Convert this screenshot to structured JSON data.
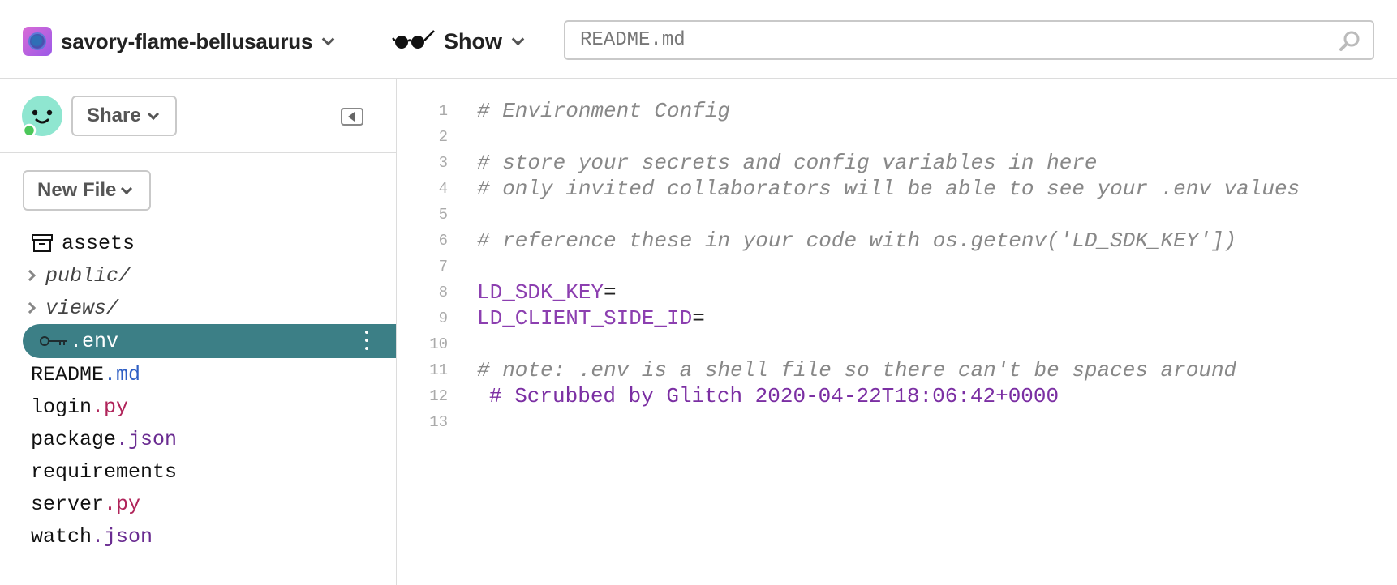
{
  "header": {
    "project_name": "savory-flame-bellusaurus",
    "show_label": "Show",
    "search_value": "README.md"
  },
  "sidebar": {
    "share_label": "Share",
    "new_file_label": "New File",
    "files": [
      {
        "name": "assets",
        "ext": "",
        "kind": "assets"
      },
      {
        "name": "public/",
        "ext": "",
        "kind": "folder"
      },
      {
        "name": "views/",
        "ext": "",
        "kind": "folder"
      },
      {
        "name": ".env",
        "ext": "",
        "kind": "env",
        "active": true
      },
      {
        "name": "README",
        "ext": ".md",
        "ext_color": "#2f5fc4"
      },
      {
        "name": "login",
        "ext": ".py",
        "ext_color": "#b0245a"
      },
      {
        "name": "package",
        "ext": ".json",
        "ext_color": "#6a2c91"
      },
      {
        "name": "requirements",
        "ext": ""
      },
      {
        "name": "server",
        "ext": ".py",
        "ext_color": "#b0245a"
      },
      {
        "name": "watch",
        "ext": ".json",
        "ext_color": "#6a2c91"
      }
    ]
  },
  "editor": {
    "lines": [
      {
        "n": "1",
        "text": "# Environment Config",
        "type": "comment"
      },
      {
        "n": "2",
        "text": "",
        "type": "plain"
      },
      {
        "n": "3",
        "text": "# store your secrets and config variables in here",
        "type": "comment"
      },
      {
        "n": "4",
        "text": "# only invited collaborators will be able to see your .env values",
        "type": "comment"
      },
      {
        "n": "5",
        "text": "",
        "type": "plain"
      },
      {
        "n": "6",
        "text": "# reference these in your code with os.getenv('LD_SDK_KEY'])",
        "type": "comment"
      },
      {
        "n": "7",
        "text": "",
        "type": "plain"
      },
      {
        "n": "8",
        "text": "LD_SDK_KEY",
        "suffix": "=",
        "type": "key"
      },
      {
        "n": "9",
        "text": "LD_CLIENT_SIDE_ID",
        "suffix": "=",
        "type": "key"
      },
      {
        "n": "10",
        "text": "",
        "type": "plain"
      },
      {
        "n": "11",
        "text": "# note: .env is a shell file so there can't be spaces around",
        "type": "comment"
      },
      {
        "n": "12",
        "text": "# Scrubbed by Glitch 2020-04-22T18:06:42+0000",
        "type": "scrub"
      },
      {
        "n": "13",
        "text": "",
        "type": "plain"
      }
    ]
  },
  "colors": {
    "active_file_bg": "#3c7f86",
    "comment": "#888888",
    "key": "#8c3fb0",
    "online_dot": "#4cc75a"
  }
}
